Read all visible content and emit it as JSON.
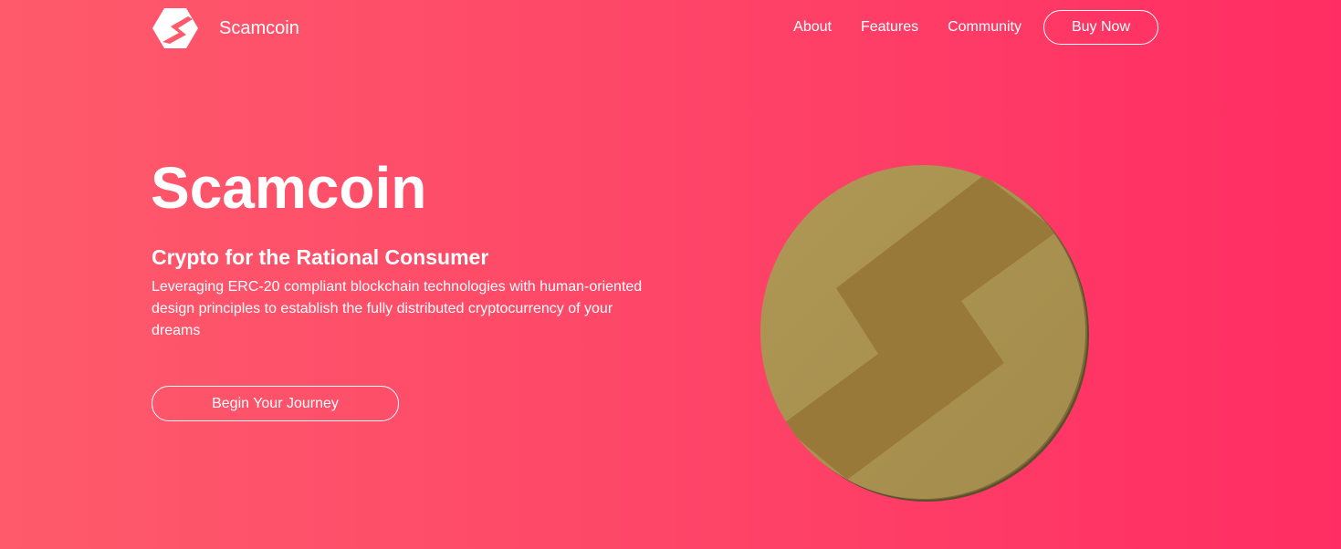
{
  "header": {
    "brand_name": "Scamcoin",
    "logo_icon": "scamcoin-logo-icon",
    "nav": [
      {
        "label": "About"
      },
      {
        "label": "Features"
      },
      {
        "label": "Community"
      }
    ],
    "buy_label": "Buy Now"
  },
  "hero": {
    "title": "Scamcoin",
    "subtitle": "Crypto for the Rational Consumer",
    "description": "Leveraging ERC-20 compliant blockchain technologies with human-oriented design principles to establish the fully distributed cryptocurrency of your dreams",
    "cta_label": "Begin Your Journey",
    "coin_icon": "scamcoin-coin-icon"
  },
  "colors": {
    "background_start": "#fe5a6b",
    "background_end": "#ff2d63",
    "coin_gold": "#a88f4e",
    "coin_shadow": "#6b5b30",
    "text": "#ffffff"
  }
}
